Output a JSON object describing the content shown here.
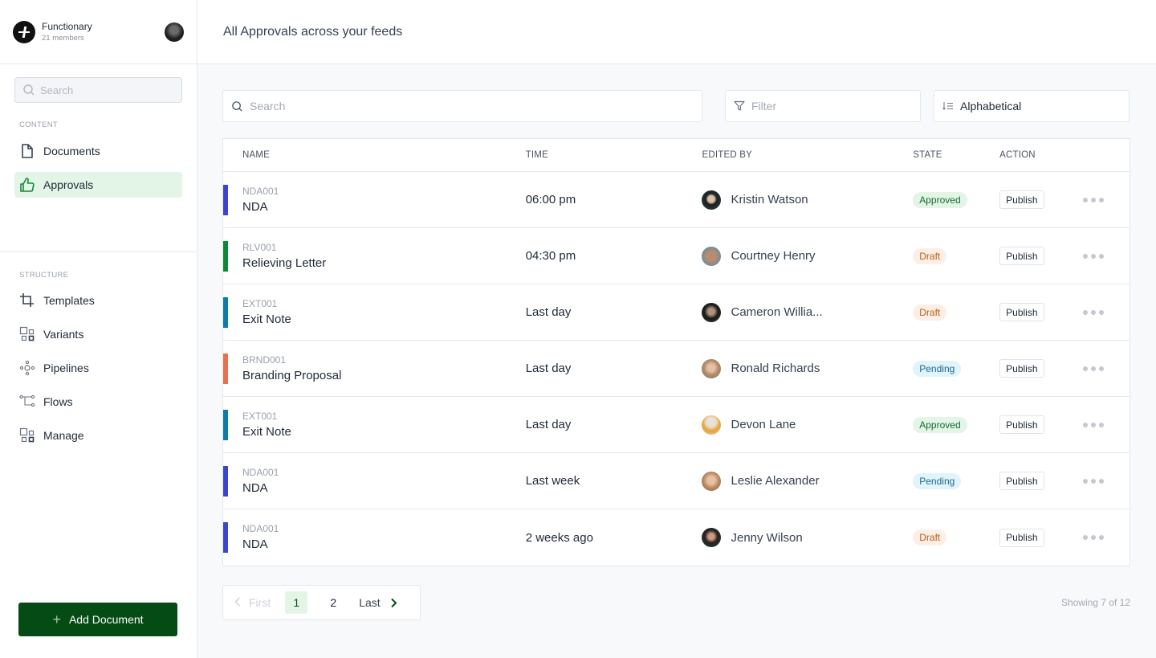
{
  "org": {
    "name": "Functionary",
    "members": "21 members"
  },
  "sidebar": {
    "search_placeholder": "Search",
    "content_label": "CONTENT",
    "content_items": [
      {
        "label": "Documents",
        "icon": "document-icon",
        "active": false
      },
      {
        "label": "Approvals",
        "icon": "thumbs-up-icon",
        "active": true
      }
    ],
    "structure_label": "STRUCTURE",
    "structure_items": [
      {
        "label": "Templates",
        "icon": "crop-icon"
      },
      {
        "label": "Variants",
        "icon": "grid-squares-icon"
      },
      {
        "label": "Pipelines",
        "icon": "nodes-icon"
      },
      {
        "label": "Flows",
        "icon": "flow-icon"
      },
      {
        "label": "Manage",
        "icon": "grid-squares-icon"
      }
    ],
    "add_button": "Add Document"
  },
  "header": {
    "title": "All Approvals across your feeds"
  },
  "toolbar": {
    "search_placeholder": "Search",
    "filter_placeholder": "Filter",
    "sort_value": "Alphabetical"
  },
  "table": {
    "columns": [
      "NAME",
      "TIME",
      "EDITED BY",
      "STATE",
      "ACTION"
    ],
    "rows": [
      {
        "code": "NDA001",
        "name": "NDA",
        "time": "06:00 pm",
        "editor": "Kristin Watson",
        "state": "Approved",
        "action": "Publish",
        "color": "#3b46cf"
      },
      {
        "code": "RLV001",
        "name": "Relieving Letter",
        "time": "04:30 pm",
        "editor": "Courtney Henry",
        "state": "Draft",
        "action": "Publish",
        "color": "#0d8a35"
      },
      {
        "code": "EXT001",
        "name": "Exit Note",
        "time": "Last day",
        "editor": "Cameron Willia...",
        "state": "Draft",
        "action": "Publish",
        "color": "#0a7ea4"
      },
      {
        "code": "BRND001",
        "name": "Branding Proposal",
        "time": "Last day",
        "editor": "Ronald Richards",
        "state": "Pending",
        "action": "Publish",
        "color": "#e8704f"
      },
      {
        "code": "EXT001",
        "name": "Exit Note",
        "time": "Last day",
        "editor": "Devon Lane",
        "state": "Approved",
        "action": "Publish",
        "color": "#0a7ea4"
      },
      {
        "code": "NDA001",
        "name": "NDA",
        "time": "Last week",
        "editor": "Leslie Alexander",
        "state": "Pending",
        "action": "Publish",
        "color": "#3b46cf"
      },
      {
        "code": "NDA001",
        "name": "NDA",
        "time": "2 weeks ago",
        "editor": "Jenny Wilson",
        "state": "Draft",
        "action": "Publish",
        "color": "#3b46cf"
      }
    ]
  },
  "pagination": {
    "first": "First",
    "pages": [
      "1",
      "2"
    ],
    "current": "1",
    "last": "Last",
    "showing": "Showing 7 of 12"
  }
}
